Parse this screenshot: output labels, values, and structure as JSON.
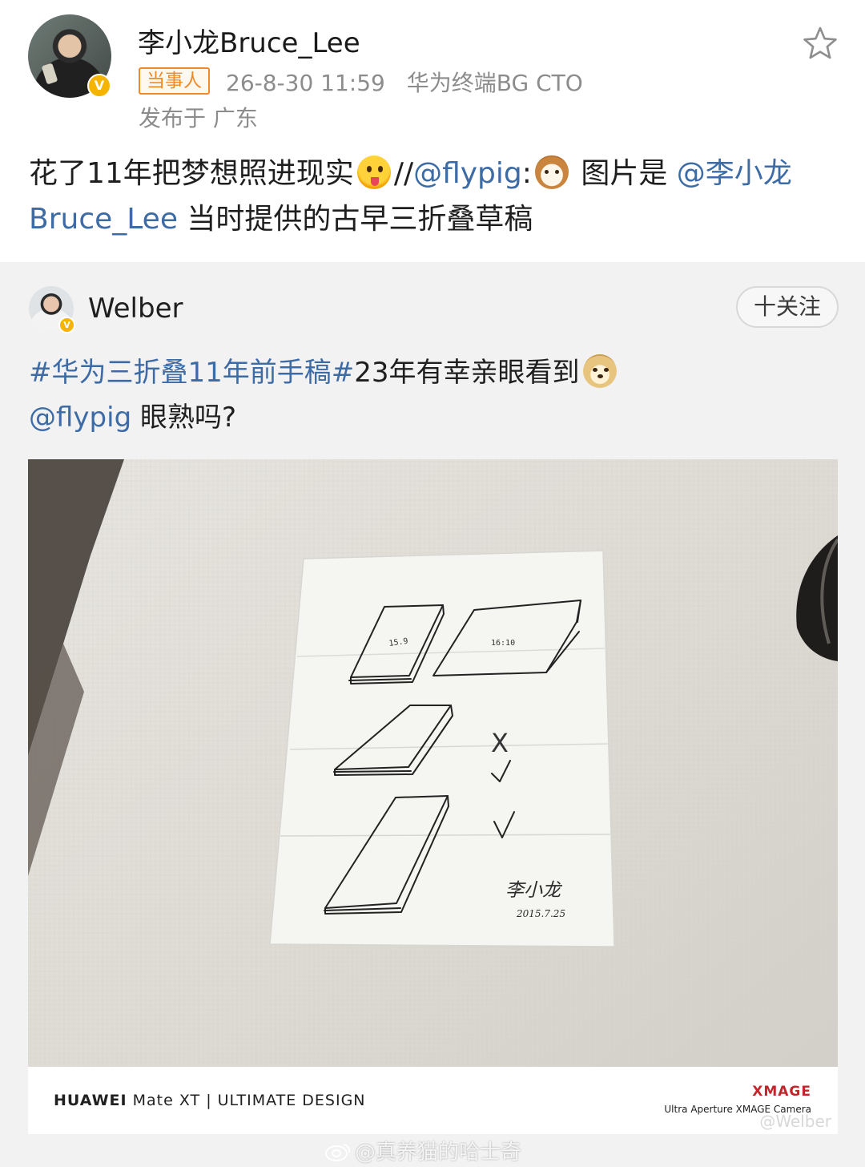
{
  "post": {
    "author": "李小龙Bruce_Lee",
    "badge": "当事人",
    "date": "26-8-30 11:59",
    "source": "华为终端BG CTO",
    "location": "发布于 广东",
    "text_1": "花了11年把梦想照进现实",
    "text_2": "//",
    "mention_1": "@flypig",
    "text_3": ":",
    "text_4": " 图片是 ",
    "mention_2": "@李小龙Bruce_Lee",
    "text_5": " 当时提供的古早三折叠草稿"
  },
  "repost": {
    "author": "Welber",
    "follow_label": "十关注",
    "topic": "#华为三折叠11年前手稿#",
    "text_1": "23年有幸亲眼看到",
    "mention": "@flypig",
    "text_2": " 眼熟吗?",
    "photo": {
      "sketch_label_1": "15.9",
      "sketch_label_2": "16:10",
      "mark_x": "X",
      "signature": "李小龙",
      "sketch_date": "2015.7.25",
      "brand": "HUAWEI",
      "model_line": " Mate XT | ULTIMATE DESIGN",
      "xmage_logo": "XMAGE",
      "camera_line": "Ultra Aperture XMAGE Camera",
      "photo_watermark": "@Welber"
    }
  },
  "watermark": "@真养猫的哈士奇",
  "icons": {
    "star": "star-outline-icon",
    "verified": "verified-badge-icon",
    "weibo": "weibo-logo-icon"
  },
  "colors": {
    "link": "#3d6ba6",
    "badge_orange": "#f08a26",
    "verified_yellow": "#f5b400",
    "xmage_red": "#c6242b"
  }
}
